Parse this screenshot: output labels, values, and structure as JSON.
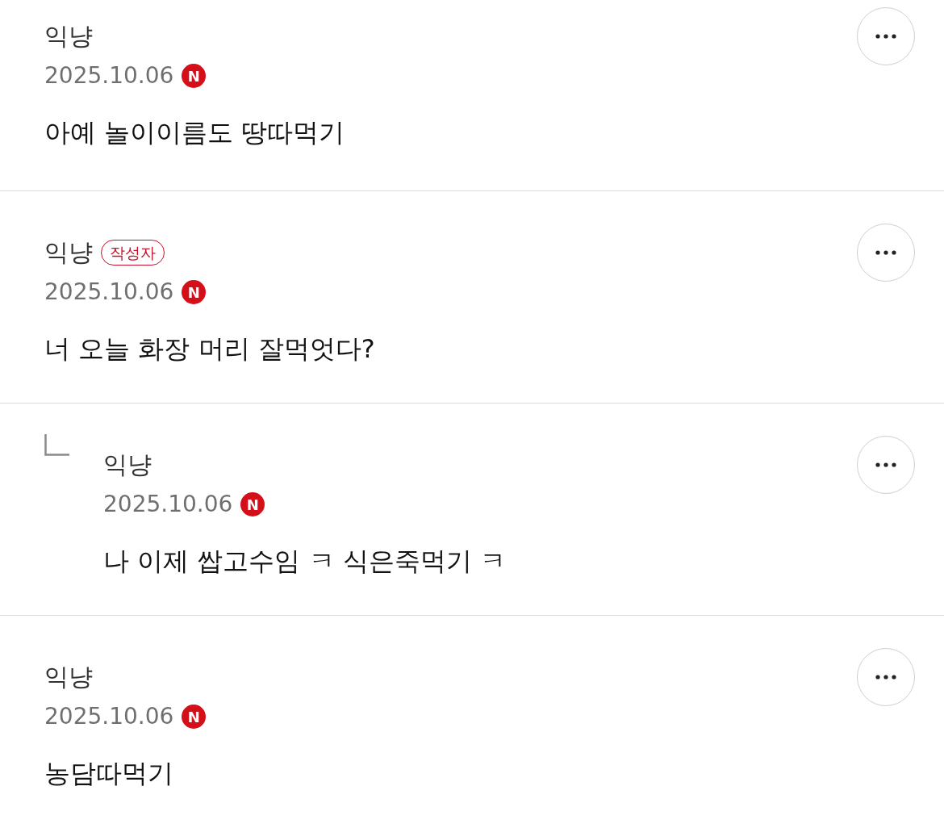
{
  "comments": [
    {
      "kind": "comment",
      "author": "익냥",
      "date": "2025.10.06",
      "new_mark": "N",
      "text": "아예 놀이이름도 땅따먹기"
    },
    {
      "kind": "comment",
      "author": "익냥",
      "author_badge": "작성자",
      "date": "2025.10.06",
      "new_mark": "N",
      "text": "너 오늘 화장 머리 잘먹엇다?"
    },
    {
      "kind": "reply",
      "author": "익냥",
      "date": "2025.10.06",
      "new_mark": "N",
      "text": "나 이제 쌉고수임 ㅋ 식은죽먹기 ㅋ"
    },
    {
      "kind": "comment",
      "author": "익냥",
      "date": "2025.10.06",
      "new_mark": "N",
      "text": "농담따먹기"
    }
  ]
}
